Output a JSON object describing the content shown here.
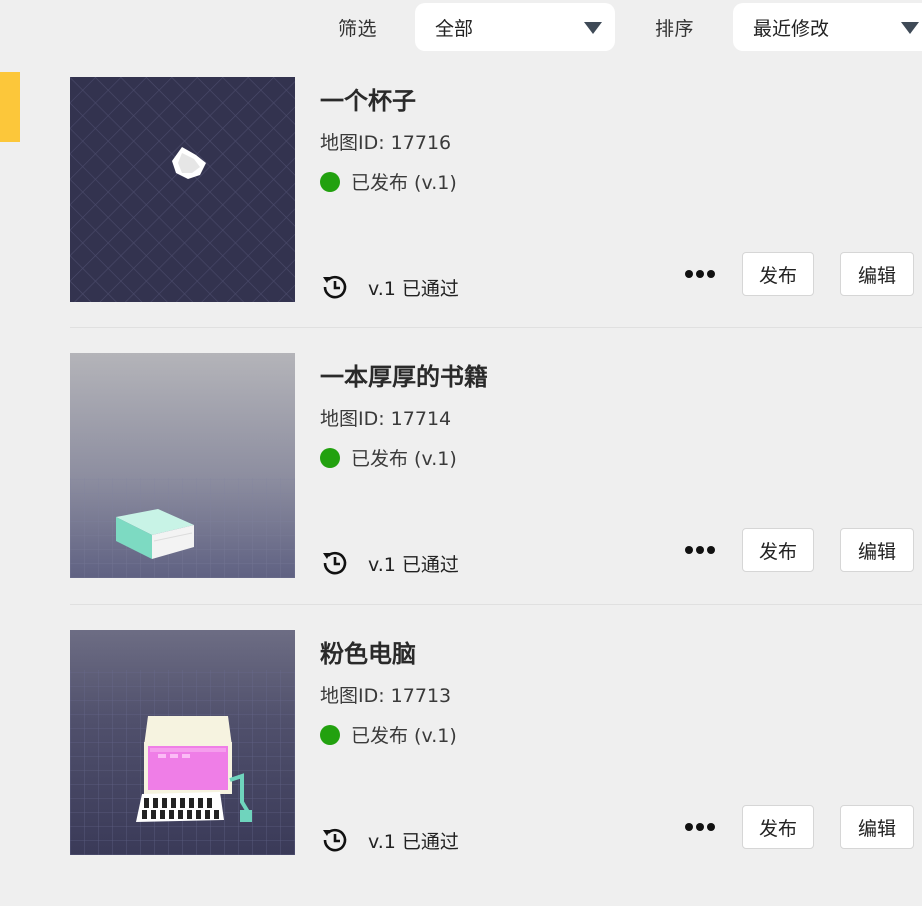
{
  "toolbar": {
    "filter_label": "筛选",
    "filter_value": "全部",
    "sort_label": "排序",
    "sort_value": "最近修改"
  },
  "colors": {
    "accent": "#fcc73a",
    "status_published": "#22a10f"
  },
  "maps": [
    {
      "title": "一个杯子",
      "map_id": "地图ID: 17716",
      "status": "已发布 (v.1)",
      "history": "v.1 已通过",
      "publish_label": "发布",
      "edit_label": "编辑",
      "thumbnail": "cup-thumbnail"
    },
    {
      "title": "一本厚厚的书籍",
      "map_id": "地图ID: 17714",
      "status": "已发布 (v.1)",
      "history": "v.1 已通过",
      "publish_label": "发布",
      "edit_label": "编辑",
      "thumbnail": "book-thumbnail"
    },
    {
      "title": "粉色电脑",
      "map_id": "地图ID: 17713",
      "status": "已发布 (v.1)",
      "history": "v.1 已通过",
      "publish_label": "发布",
      "edit_label": "编辑",
      "thumbnail": "pink-computer-thumbnail"
    }
  ]
}
